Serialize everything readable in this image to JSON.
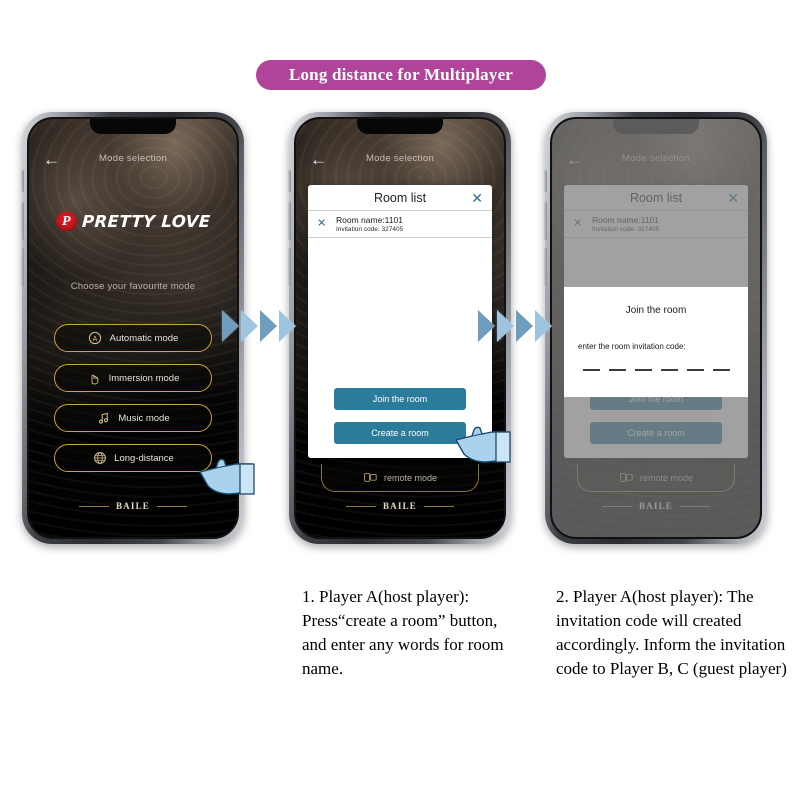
{
  "banner": {
    "title": "Long distance for Multiplayer",
    "color": "#b0449a"
  },
  "colors": {
    "accent_teal": "#2b7b9b",
    "gold_border": "#c9a24a",
    "arrow_blue": "#9dc5e0",
    "logo_red": "#d0191f"
  },
  "phone_screen": {
    "header_title": "Mode selection",
    "back_icon": "back-arrow-icon",
    "logo_mark": "P",
    "logo_text": "PRETTY LOVE",
    "subtitle": "Choose your favourite mode",
    "modes": [
      {
        "label": "Automatic mode",
        "icon": "automatic-circle-a-icon"
      },
      {
        "label": "Immersion mode",
        "icon": "hand-pointer-icon"
      },
      {
        "label": "Music mode",
        "icon": "music-note-icon"
      },
      {
        "label": "Long-distance",
        "icon": "globe-icon"
      }
    ],
    "remote_mode": {
      "label": "remote mode",
      "icon": "remote-control-icon"
    },
    "footer_brand": "BAILE"
  },
  "room_list_dialog": {
    "title": "Room list",
    "close_icon": "close-x-icon",
    "row": {
      "close_icon": "close-x-icon",
      "room_name": "Room name:1101",
      "invitation_code": "Invitation code: 327405"
    },
    "buttons": [
      {
        "label": "Join the room",
        "name": "join-the-room-button"
      },
      {
        "label": "Create a room",
        "name": "create-a-room-button"
      }
    ]
  },
  "join_room_overlay": {
    "title": "Join the room",
    "field_label": "enter the room invitation code:",
    "code_slots": 6
  },
  "arrows": {
    "icon": "chevron-right-icon",
    "count_per_group": 4
  },
  "cursors": {
    "icon": "pointing-hand-cursor-icon"
  },
  "captions": {
    "step_1": "1. Player A(host player): Press“create a room” button, and enter any words for room name.",
    "step_2": "2. Player A(host player): The invitation code will created accordingly. Inform the invitation code to Player B, C (guest player)"
  }
}
